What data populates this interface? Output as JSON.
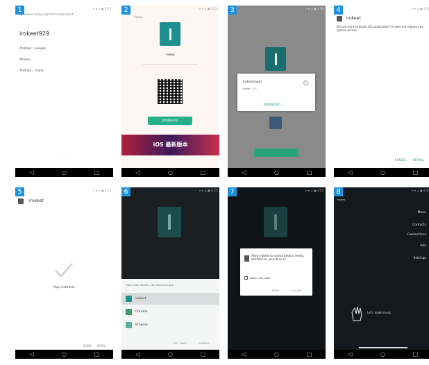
{
  "badges": [
    "1",
    "2",
    "3",
    "4",
    "5",
    "6",
    "7",
    "8"
  ],
  "status_bar": "≡ ▾ ⊿ ▣ 4:54",
  "panel1": {
    "url": "ttp://www.irokey.org/download/android/...",
    "title": "irokeet929",
    "rows": [
      "Android : Google",
      "iPhone",
      "Android : China"
    ],
    "footer": "⋯"
  },
  "panel2": {
    "top_label": "irokey",
    "tag_label": "irokey",
    "download_label": "DOWNLOAD",
    "banner_text": "iOS 最新版本"
  },
  "panel3": {
    "dialog_title": "irokeet(apk)",
    "dialog_sub": "irokey · 1.0",
    "dialog_link": "DOWNLOAD"
  },
  "panel4": {
    "header": "irokeet",
    "body": "Do you want to install this application? It does not require any special access.",
    "cancel": "CANCEL",
    "install": "INSTALL"
  },
  "panel5": {
    "header": "irokeet",
    "status": "App installed.",
    "done": "DONE",
    "open": "OPEN"
  },
  "panel6": {
    "prompt": "Open with irokeet, the following app",
    "items": [
      "irokeet",
      "Chrome",
      "Browser"
    ],
    "just_once": "JUST ONCE",
    "always": "ALWAYS"
  },
  "panel7": {
    "dialog_text": "Allow irokeet to access photos, media and files on your device?",
    "checkbox_label": "Never ask again",
    "deny": "DENY",
    "allow": "ALLOW"
  },
  "panel8": {
    "corner_label": "irokeet",
    "menu": [
      "Menu",
      "Contacts",
      "Connections",
      "Add",
      "Settings"
    ],
    "center_label": "Let's make music",
    "bottom_bar": "—"
  },
  "nav": {
    "back": "◁",
    "home": "○",
    "recent": "□"
  },
  "colors": {
    "badge": "#1e90e0",
    "accent_teal": "#1f8f8f",
    "accent_green": "#26b08a",
    "nav_black": "#000000"
  }
}
